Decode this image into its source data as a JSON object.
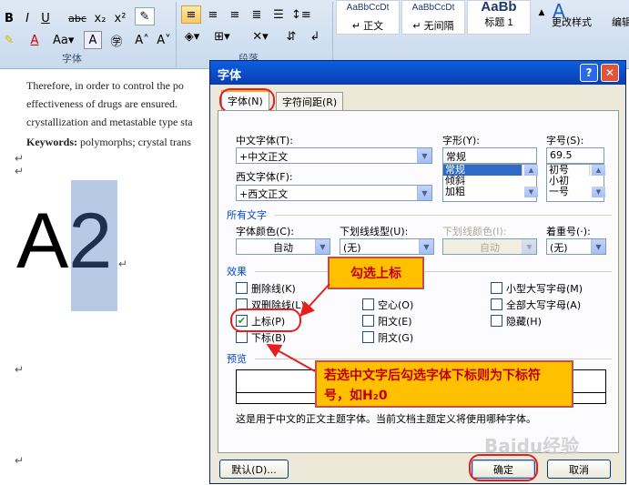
{
  "ribbon": {
    "font_group_label": "字体",
    "para_group_label": "段落",
    "styles": [
      {
        "preview": "AaBbCcDt",
        "name": "↵ 正文"
      },
      {
        "preview": "AaBbCcDt",
        "name": "↵ 无间隔"
      },
      {
        "preview": "AaBb",
        "name": "标题 1"
      }
    ],
    "change_styles": "更改样式",
    "edit": "编辑"
  },
  "document": {
    "line1": "Therefore,  in  order  to  control  the  po",
    "line2": "effectiveness  of  drugs  are  ensured.",
    "line3": "crystallization and metastable type sta",
    "line4_bold": "Keywords:",
    "line4_rest": " polymorphs; crystal trans",
    "big_text_base": "A",
    "big_text_sel": "2",
    "para_mark": "↵"
  },
  "dialog": {
    "title": "字体",
    "tabs": [
      "字体(N)",
      "字符间距(R)"
    ],
    "chinese_font_label": "中文字体(T):",
    "chinese_font_value": "+中文正文",
    "western_font_label": "西文字体(F):",
    "western_font_value": "+西文正文",
    "style_label": "字形(Y):",
    "style_value": "常规",
    "style_options": [
      "常规",
      "倾斜",
      "加粗"
    ],
    "size_label": "字号(S):",
    "size_value": "69.5",
    "size_options": [
      "初号",
      "小初",
      "一号"
    ],
    "all_text_section": "所有文字",
    "font_color_label": "字体颜色(C):",
    "font_color_value": "自动",
    "underline_label": "下划线线型(U):",
    "underline_value": "(无)",
    "underline_color_label": "下划线颜色(I):",
    "underline_color_value": "自动",
    "emphasis_label": "着重号(·):",
    "emphasis_value": "(无)",
    "effects_section": "效果",
    "effects_col1": [
      {
        "label": "删除线(K)",
        "checked": false
      },
      {
        "label": "双删除线(L)",
        "checked": false
      },
      {
        "label": "上标(P)",
        "checked": true
      },
      {
        "label": "下标(B)",
        "checked": false
      }
    ],
    "effects_col2": [
      {
        "label": "空心(O)",
        "checked": false
      },
      {
        "label": "阳文(E)",
        "checked": false
      },
      {
        "label": "阴文(G)",
        "checked": false
      }
    ],
    "effects_col3": [
      {
        "label": "小型大写字母(M)",
        "checked": false
      },
      {
        "label": "全部大写字母(A)",
        "checked": false
      },
      {
        "label": "隐藏(H)",
        "checked": false
      }
    ],
    "preview_section": "预览",
    "preview_note": "这是用于中文的正文主题字体。当前文档主题定义将使用哪种字体。",
    "default_button": "默认(D)...",
    "ok_button": "确定",
    "cancel_button": "取消"
  },
  "annotations": {
    "callout1": "勾选上标",
    "callout2": "若选中文字后勾选字体下标则为下标符号，如H₂0"
  },
  "watermark": "Baidu经验"
}
